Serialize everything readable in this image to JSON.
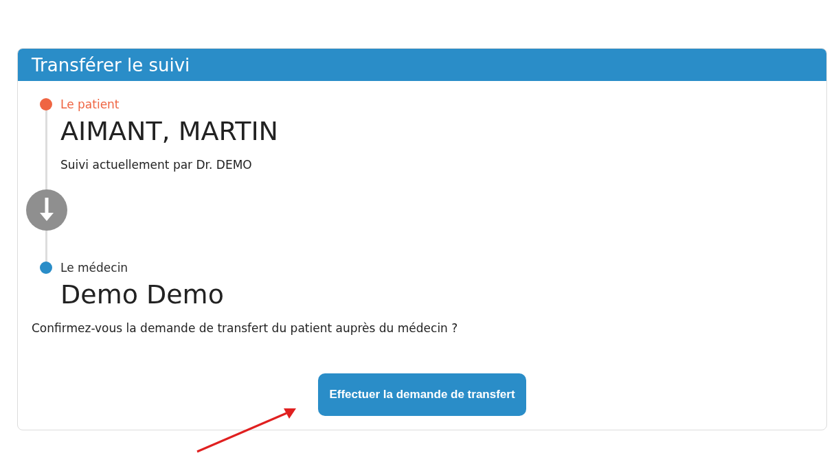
{
  "panel": {
    "title": "Transférer le suivi"
  },
  "steps": [
    {
      "kind": "origin",
      "label": "Le patient",
      "name": "AIMANT, MARTIN",
      "detail": "Suivi actuellement par Dr. DEMO",
      "color": "#ef6542"
    },
    {
      "kind": "destination",
      "label": "Le médecin",
      "name": "Demo Demo",
      "color": "#2a8dc8"
    }
  ],
  "question": "Confirmez-vous la demande de transfert du patient auprès du médecin ?",
  "button": "Effectuer la demande de transfert"
}
